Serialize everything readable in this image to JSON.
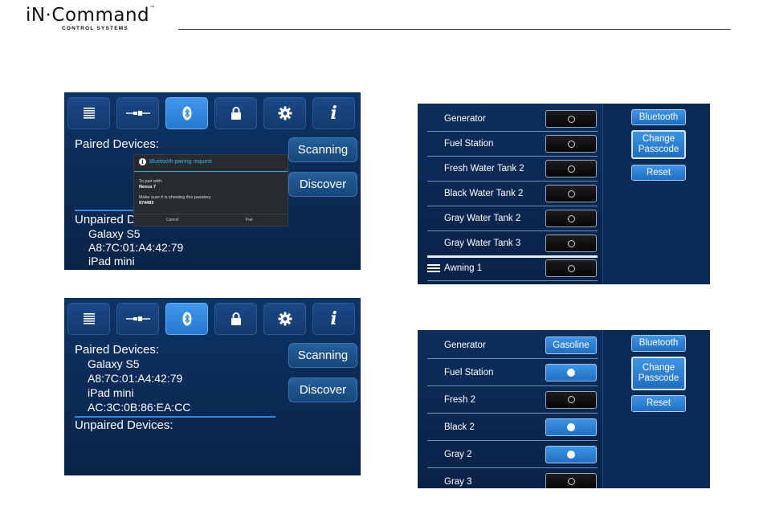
{
  "header": {
    "brand": "iN·Command",
    "trademark": "™",
    "subtitle": "CONTROL SYSTEMS"
  },
  "colors": {
    "accent": "#2d8be0",
    "toggle_on": "#2f82d6",
    "panel_bg": "#0b2a55"
  },
  "tabs": [
    {
      "icon": "list-icon"
    },
    {
      "icon": "connector-icon"
    },
    {
      "icon": "bluetooth-icon"
    },
    {
      "icon": "lock-icon"
    },
    {
      "icon": "gear-icon"
    },
    {
      "icon": "info-icon",
      "glyph": "i"
    }
  ],
  "screen1": {
    "paired_label": "Paired Devices:",
    "unpaired_label": "Unpaired Dev",
    "scanning_label": "Scanning",
    "discover_label": "Discover",
    "unpaired_devices": [
      {
        "name": "Galaxy S5",
        "address": "A8:7C:01:A4:42:79"
      },
      {
        "name": "iPad mini"
      }
    ],
    "dialog": {
      "title": "Bluetooth pairing request",
      "line1": "To pair with:",
      "device": "Nexus 7",
      "line2": "Make sure it is showing this passkey:",
      "passkey": "974493",
      "cancel": "Cancel",
      "pair": "Pair"
    }
  },
  "screen2": {
    "paired_label": "Paired Devices:",
    "unpaired_label": "Unpaired Devices:",
    "scanning_label": "Scanning",
    "discover_label": "Discover",
    "paired_devices": [
      {
        "name": "Galaxy S5",
        "address": "A8:7C:01:A4:42:79"
      },
      {
        "name": "iPad mini",
        "address": "AC:3C:0B:86:EA:CC"
      }
    ]
  },
  "list1": {
    "rows": [
      {
        "label": "Generator",
        "state": "off"
      },
      {
        "label": "Fuel Station",
        "state": "off"
      },
      {
        "label": "Fresh Water Tank 2",
        "state": "off"
      },
      {
        "label": "Black Water Tank 2",
        "state": "off"
      },
      {
        "label": "Gray Water Tank 2",
        "state": "off"
      },
      {
        "label": "Gray Water Tank 3",
        "state": "off",
        "selected": true
      },
      {
        "label": "Awning 1",
        "state": "off",
        "drag": true
      }
    ],
    "buttons": {
      "bluetooth": "Bluetooth",
      "change_1": "Change",
      "change_2": "Passcode",
      "reset": "Reset"
    }
  },
  "list2": {
    "rows": [
      {
        "label": "Generator",
        "state": "text",
        "value": "Gasoline"
      },
      {
        "label": "Fuel Station",
        "state": "on"
      },
      {
        "label": "Fresh 2",
        "state": "off"
      },
      {
        "label": "Black 2",
        "state": "on"
      },
      {
        "label": "Gray 2",
        "state": "on"
      },
      {
        "label": "Gray 3",
        "state": "off"
      }
    ],
    "buttons": {
      "bluetooth": "Bluetooth",
      "change_1": "Change",
      "change_2": "Passcode",
      "reset": "Reset"
    }
  }
}
